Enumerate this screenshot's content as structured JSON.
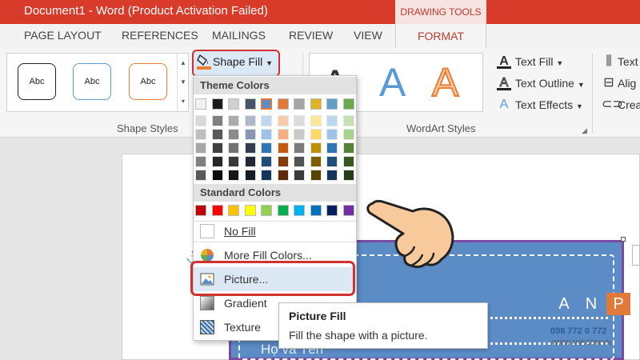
{
  "window": {
    "title": "Document1 -  Word (Product Activation Failed)",
    "context_tab_group": "DRAWING TOOLS"
  },
  "tabs": [
    {
      "label": "PAGE LAYOUT"
    },
    {
      "label": "REFERENCES"
    },
    {
      "label": "MAILINGS"
    },
    {
      "label": "REVIEW"
    },
    {
      "label": "VIEW"
    },
    {
      "label": "FORMAT",
      "active": true
    }
  ],
  "ribbon": {
    "shape_styles": {
      "label": "Shape Styles",
      "presets": [
        {
          "text": "Abc",
          "border_color": "#222222"
        },
        {
          "text": "Abc",
          "border_color": "#5b9bd5"
        },
        {
          "text": "Abc",
          "border_color": "#ed7d31"
        }
      ]
    },
    "shape_fill": {
      "label": "Shape Fill"
    },
    "wordart": {
      "label": "WordArt Styles",
      "letters": [
        {
          "text": "A",
          "color": "#333333"
        },
        {
          "text": "A",
          "color": "#5b9bd5"
        },
        {
          "text": "A",
          "color": "#f4b183"
        }
      ],
      "text_fill": "Text Fill",
      "text_outline": "Text Outline",
      "text_effects": "Text Effects"
    },
    "arrange": {
      "text_direction": "Text",
      "align": "Alig",
      "create_link": "Crea"
    }
  },
  "dropdown": {
    "theme_colors_header": "Theme Colors",
    "theme_top_row": [
      "#f2f2f2",
      "#1a1a1a",
      "#d0d0d0",
      "#46546a",
      "#5b8cc6",
      "#e07a3a",
      "#a5a5a5",
      "#e0b326",
      "#5fa0c9",
      "#6aa84f"
    ],
    "theme_tint_columns": [
      [
        "#d9d9d9",
        "#bfbfbf",
        "#a6a6a6",
        "#808080",
        "#595959"
      ],
      [
        "#7f7f7f",
        "#595959",
        "#404040",
        "#262626",
        "#0d0d0d"
      ],
      [
        "#aeaaaa",
        "#8e8a8a",
        "#767171",
        "#3a3838",
        "#171616"
      ],
      [
        "#adb9ca",
        "#8496b0",
        "#323e4f",
        "#222a35",
        "#161c24"
      ],
      [
        "#bdd7ee",
        "#9dc3e6",
        "#2e75b6",
        "#1f4e79",
        "#15365a"
      ],
      [
        "#f8cbad",
        "#f4b183",
        "#c55a11",
        "#833c0b",
        "#5c2a07"
      ],
      [
        "#dbdbdb",
        "#c9c9c9",
        "#7b7b7b",
        "#525252",
        "#3a3a3a"
      ],
      [
        "#ffe699",
        "#ffd966",
        "#bf8f00",
        "#7f6000",
        "#594300"
      ],
      [
        "#bdd7ee",
        "#9dc3e6",
        "#2e75b6",
        "#1f4e79",
        "#15365a"
      ],
      [
        "#c5e0b4",
        "#a9d18e",
        "#538135",
        "#375623",
        "#263c18"
      ]
    ],
    "standard_colors_header": "Standard Colors",
    "standard_colors": [
      "#c00000",
      "#ff0000",
      "#ffc000",
      "#ffff00",
      "#92d050",
      "#00b050",
      "#00b0f0",
      "#0070c0",
      "#002060",
      "#7030a0"
    ],
    "no_fill": "No Fill",
    "more_fill_colors": "More Fill Colors...",
    "picture": "Picture...",
    "gradient": "Gradient",
    "texture": "Texture"
  },
  "tooltip": {
    "title": "Picture Fill",
    "description": "Fill the shape with a picture."
  },
  "document": {
    "shape_text": "Họ và Tên"
  },
  "logo": {
    "letters": [
      "A",
      "N",
      "P"
    ],
    "phone": "098 772 0 772",
    "website": "WWW.ANP.COM.VN"
  }
}
